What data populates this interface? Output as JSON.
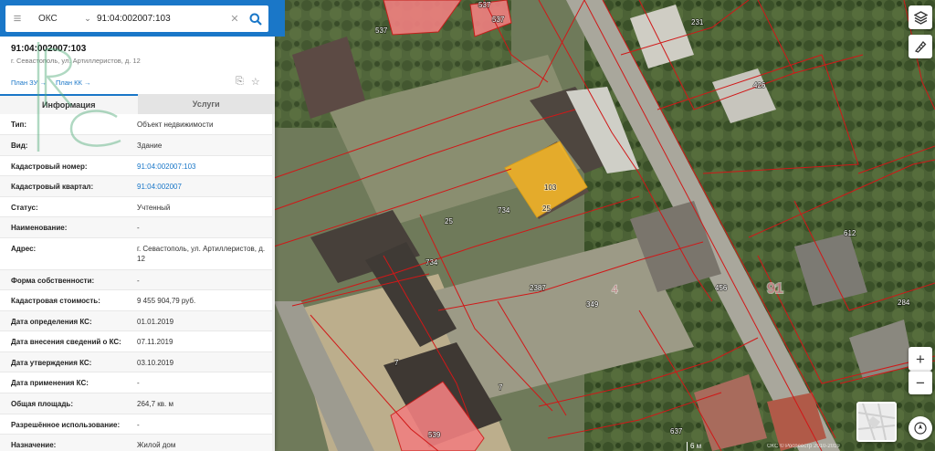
{
  "search": {
    "type": "ОКС",
    "query": "91:04:002007:103"
  },
  "object": {
    "title": "91:04:002007:103",
    "address": "г. Севастополь, ул. Артиллеристов, д. 12",
    "plan_zu": "План ЗУ",
    "plan_kk": "План КК"
  },
  "tabs": [
    "Информация",
    "Услуги"
  ],
  "rows": [
    {
      "key": "Тип:",
      "value": "Объект недвижимости"
    },
    {
      "key": "Вид:",
      "value": "Здание"
    },
    {
      "key": "Кадастровый номер:",
      "value": "91:04:002007:103"
    },
    {
      "key": "Кадастровый квартал:",
      "value": "91:04:002007"
    },
    {
      "key": "Статус:",
      "value": "Учтенный"
    },
    {
      "key": "Наименование:",
      "value": "-"
    },
    {
      "key": "Адрес:",
      "value": "г. Севастополь, ул. Артиллеристов, д. 12"
    },
    {
      "key": "Форма собственности:",
      "value": "-"
    },
    {
      "key": "Кадастровая стоимость:",
      "value": "9 455 904,79 руб."
    },
    {
      "key": "Дата определения КС:",
      "value": "01.01.2019"
    },
    {
      "key": "Дата внесения сведений о КС:",
      "value": "07.11.2019"
    },
    {
      "key": "Дата утверждения КС:",
      "value": "03.10.2019"
    },
    {
      "key": "Дата применения КС:",
      "value": "-"
    },
    {
      "key": "Общая площадь:",
      "value": "264,7 кв. м"
    },
    {
      "key": "Разрешённое использование:",
      "value": "-"
    },
    {
      "key": "Назначение:",
      "value": "Жилой дом"
    }
  ],
  "map": {
    "labels": {
      "l537a": "537",
      "l537b": "537",
      "l537c": "537",
      "l231": "231",
      "l426": "426",
      "l103": "103",
      "l25a": "25",
      "l25b": "25",
      "l734a": "734",
      "l734b": "734",
      "l2387": "2387",
      "l349": "349",
      "l4": "4",
      "l456": "456",
      "l91": "91",
      "l612": "612",
      "l284": "284",
      "l7a": "7",
      "l7b": "7",
      "l539": "539",
      "l637": "637"
    },
    "scale": "6 м",
    "copyright": "ОКС © Росреестр 2010-2019"
  },
  "colors": {
    "accent": "#1a77c8",
    "selected_building": "#f0b429",
    "highlight_parcel": "#f08080",
    "parcel_border": "#d01818"
  }
}
